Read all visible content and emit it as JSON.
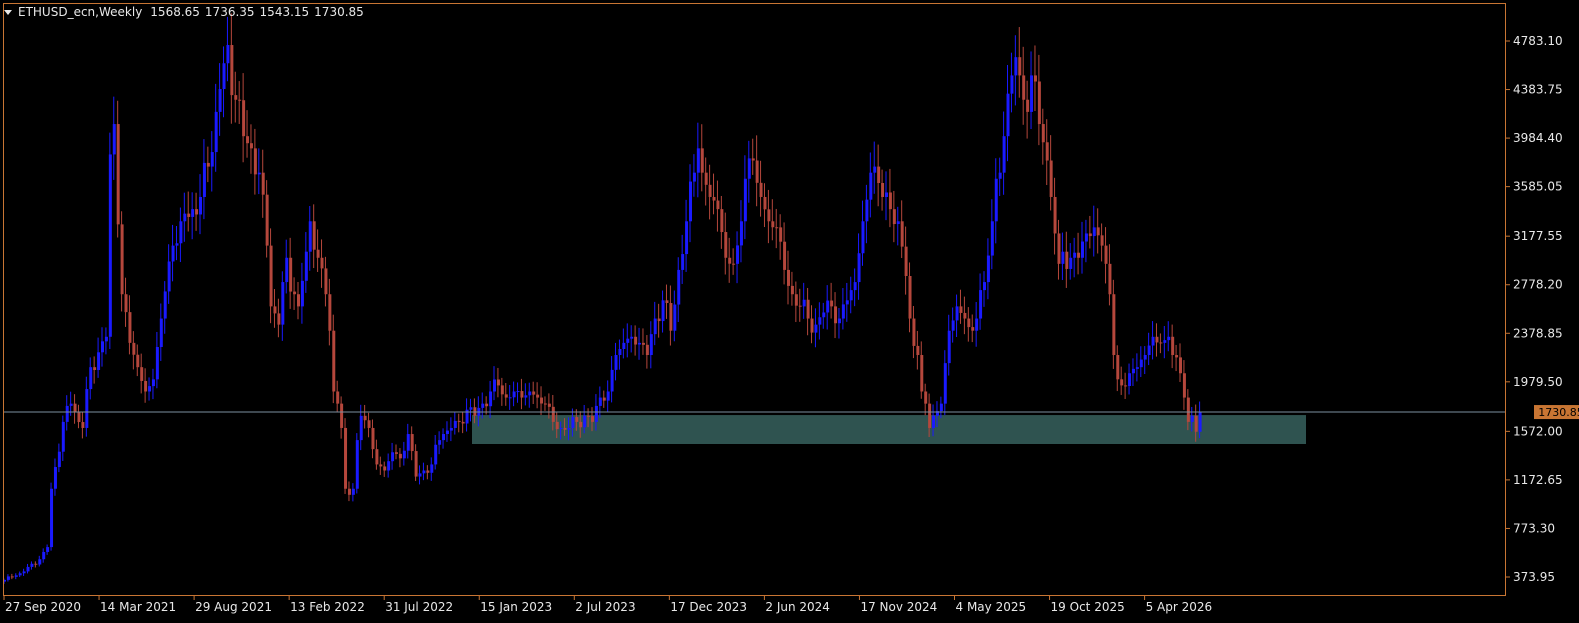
{
  "header": {
    "symbol": "ETHUSD_ecn,Weekly",
    "open": "1568.65",
    "high": "1736.35",
    "low": "1543.15",
    "close": "1730.85"
  },
  "colors": {
    "background": "#000000",
    "axis": "#c87533",
    "bull": "#1a1aff",
    "bear": "#b5473c",
    "bid_line": "#7b8fa0",
    "zone": "#2f5350",
    "text": "#e8e8e8"
  },
  "price_axis": {
    "labels": [
      "4783.10",
      "4383.75",
      "3984.40",
      "3585.05",
      "3177.55",
      "2778.20",
      "2378.85",
      "1979.50",
      "1572.00",
      "1172.65",
      "773.30",
      "373.95"
    ],
    "current_price_label": "1730.85"
  },
  "time_axis": {
    "labels": [
      "27 Sep 2020",
      "14 Mar 2021",
      "29 Aug 2021",
      "13 Feb 2022",
      "31 Jul 2022",
      "15 Jan 2023",
      "2 Jul 2023",
      "17 Dec 2023",
      "2 Jun 2024",
      "17 Nov 2024",
      "4 May 2025",
      "19 Oct 2025",
      "5 Apr 2026"
    ]
  },
  "chart_data": {
    "type": "candlestick",
    "title": "ETHUSD_ecn,Weekly",
    "interval": "Weekly",
    "ylim": [
      173,
      5063
    ],
    "current_price": 1730.85,
    "support_zone": [
      1468,
      1706
    ],
    "price_path": [
      [
        0,
        350
      ],
      [
        5,
        420
      ],
      [
        9,
        520
      ],
      [
        11,
        620
      ],
      [
        12,
        1100
      ],
      [
        15,
        1650
      ],
      [
        17,
        1800
      ],
      [
        20,
        1600
      ],
      [
        22,
        2100
      ],
      [
        26,
        2350
      ],
      [
        27,
        3850
      ],
      [
        28,
        4100
      ],
      [
        30,
        2700
      ],
      [
        32,
        2300
      ],
      [
        34,
        2100
      ],
      [
        36,
        1900
      ],
      [
        38,
        2000
      ],
      [
        40,
        2500
      ],
      [
        43,
        3100
      ],
      [
        45,
        3300
      ],
      [
        48,
        3400
      ],
      [
        50,
        3500
      ],
      [
        52,
        3750
      ],
      [
        54,
        4200
      ],
      [
        56,
        4600
      ],
      [
        57,
        4750
      ],
      [
        59,
        4300
      ],
      [
        61,
        4000
      ],
      [
        63,
        3900
      ],
      [
        65,
        3700
      ],
      [
        67,
        3100
      ],
      [
        68,
        2600
      ],
      [
        70,
        2450
      ],
      [
        72,
        3000
      ],
      [
        74,
        2700
      ],
      [
        75,
        2600
      ],
      [
        77,
        3050
      ],
      [
        78,
        3300
      ],
      [
        80,
        3000
      ],
      [
        82,
        2700
      ],
      [
        83,
        2400
      ],
      [
        84,
        1900
      ],
      [
        85,
        1800
      ],
      [
        86,
        1600
      ],
      [
        87,
        1100
      ],
      [
        88,
        1050
      ],
      [
        89,
        1100
      ],
      [
        90,
        1500
      ],
      [
        91,
        1700
      ],
      [
        93,
        1600
      ],
      [
        95,
        1300
      ],
      [
        97,
        1250
      ],
      [
        99,
        1400
      ],
      [
        101,
        1350
      ],
      [
        103,
        1550
      ],
      [
        105,
        1200
      ],
      [
        107,
        1250
      ],
      [
        109,
        1300
      ],
      [
        111,
        1500
      ],
      [
        112,
        1550
      ],
      [
        114,
        1600
      ],
      [
        116,
        1650
      ],
      [
        118,
        1750
      ],
      [
        120,
        1700
      ],
      [
        122,
        1800
      ],
      [
        124,
        1900
      ],
      [
        126,
        1950
      ],
      [
        128,
        1850
      ],
      [
        130,
        1900
      ],
      [
        132,
        1850
      ],
      [
        134,
        1900
      ],
      [
        136,
        1850
      ],
      [
        138,
        1800
      ],
      [
        140,
        1650
      ],
      [
        142,
        1600
      ],
      [
        144,
        1600
      ],
      [
        146,
        1650
      ],
      [
        148,
        1700
      ],
      [
        150,
        1650
      ],
      [
        152,
        1850
      ],
      [
        154,
        1900
      ],
      [
        156,
        2200
      ],
      [
        158,
        2300
      ],
      [
        160,
        2350
      ],
      [
        162,
        2300
      ],
      [
        164,
        2200
      ],
      [
        166,
        2500
      ],
      [
        168,
        2650
      ],
      [
        170,
        2400
      ],
      [
        172,
        2900
      ],
      [
        174,
        3300
      ],
      [
        176,
        3700
      ],
      [
        177,
        3900
      ],
      [
        178,
        3700
      ],
      [
        180,
        3500
      ],
      [
        182,
        3400
      ],
      [
        184,
        3000
      ],
      [
        186,
        2950
      ],
      [
        188,
        3300
      ],
      [
        189,
        3650
      ],
      [
        191,
        3800
      ],
      [
        193,
        3500
      ],
      [
        195,
        3300
      ],
      [
        197,
        3250
      ],
      [
        199,
        2900
      ],
      [
        201,
        2700
      ],
      [
        203,
        2600
      ],
      [
        205,
        2500
      ],
      [
        207,
        2450
      ],
      [
        209,
        2550
      ],
      [
        211,
        2600
      ],
      [
        213,
        2500
      ],
      [
        215,
        2650
      ],
      [
        217,
        2800
      ],
      [
        219,
        3300
      ],
      [
        221,
        3700
      ],
      [
        222,
        3750
      ],
      [
        224,
        3500
      ],
      [
        226,
        3400
      ],
      [
        228,
        3300
      ],
      [
        230,
        2850
      ],
      [
        231,
        2500
      ],
      [
        233,
        2200
      ],
      [
        234,
        1900
      ],
      [
        235,
        1800
      ],
      [
        236,
        1600
      ],
      [
        237,
        1700
      ],
      [
        239,
        1800
      ],
      [
        241,
        2400
      ],
      [
        243,
        2600
      ],
      [
        245,
        2500
      ],
      [
        247,
        2400
      ],
      [
        248,
        2500
      ],
      [
        250,
        2800
      ],
      [
        252,
        3300
      ],
      [
        253,
        3650
      ],
      [
        254,
        3700
      ],
      [
        255,
        4000
      ],
      [
        256,
        4350
      ],
      [
        257,
        4500
      ],
      [
        258,
        4650
      ],
      [
        259,
        4500
      ],
      [
        260,
        4300
      ],
      [
        261,
        4200
      ],
      [
        262,
        4500
      ],
      [
        263,
        4450
      ],
      [
        264,
        4100
      ],
      [
        265,
        3950
      ],
      [
        266,
        3800
      ],
      [
        267,
        3500
      ],
      [
        268,
        3200
      ],
      [
        269,
        2950
      ],
      [
        270,
        3050
      ],
      [
        272,
        3000
      ],
      [
        274,
        3000
      ],
      [
        276,
        3200
      ],
      [
        278,
        3250
      ],
      [
        280,
        3100
      ],
      [
        281,
        2950
      ],
      [
        282,
        2700
      ],
      [
        283,
        2200
      ],
      [
        284,
        2000
      ],
      [
        285,
        1950
      ],
      [
        287,
        2050
      ],
      [
        289,
        2100
      ],
      [
        291,
        2200
      ],
      [
        293,
        2350
      ],
      [
        295,
        2300
      ],
      [
        297,
        2350
      ],
      [
        298,
        2200
      ],
      [
        300,
        2050
      ],
      [
        301,
        1850
      ],
      [
        302,
        1650
      ],
      [
        303,
        1700
      ],
      [
        304,
        1568.65
      ],
      [
        305,
        1730.85
      ]
    ]
  }
}
